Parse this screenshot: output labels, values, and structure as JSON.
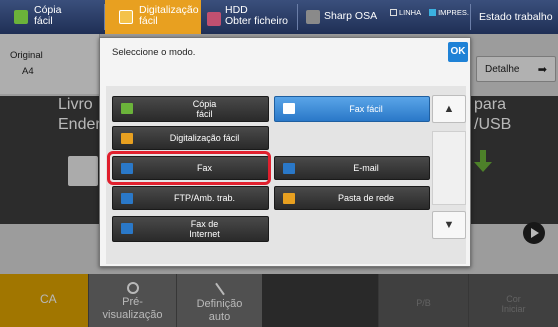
{
  "topbar": {
    "tabs": [
      {
        "label": "Cópia\nfácil",
        "icon": "copy-icon",
        "color": "#6bb33a"
      },
      {
        "label": "Digitalização\nfácil",
        "icon": "scan-icon",
        "color": "#e8a020"
      },
      {
        "label": "HDD\nObter ficheiro",
        "icon": "hdd-icon",
        "color": "#c05070"
      },
      {
        "label": "Sharp OSA",
        "icon": "osa-icon",
        "color": "#8a8a8a"
      }
    ],
    "status_line": "LINHA",
    "status_print": "IMPRES.",
    "job_status": "Estado trabalho"
  },
  "home": {
    "original_label": "Original",
    "original_size": "A4",
    "detail_label": "Detalhe",
    "bg_left_1": "Livro",
    "bg_left_2": "Ender",
    "bg_right_1": "para",
    "bg_right_2": "/USB"
  },
  "bottombar": {
    "ca_label": "CA",
    "preview_label": "Pré-\nvisualização",
    "auto_label": "Definição\nauto",
    "bw_label": "P/B",
    "color_label": "Cor\nIniciar"
  },
  "modal": {
    "title": "Seleccione o modo.",
    "ok_label": "OK",
    "modes": [
      {
        "label": "Cópia\nfácil",
        "icon": "copy-icon",
        "color": "#6bb33a",
        "selected": false
      },
      {
        "label": "Fax fácil",
        "icon": "fax-easy-icon",
        "color": "#2a78c8",
        "selected": true
      },
      {
        "label": "Digitalização fácil",
        "icon": "scan-icon",
        "color": "#e8a020",
        "selected": false
      },
      {
        "label": "Fax",
        "icon": "fax-icon",
        "color": "#2a78c8",
        "selected": false
      },
      {
        "label": "E-mail",
        "icon": "email-icon",
        "color": "#2a78c8",
        "selected": false
      },
      {
        "label": "FTP/Amb. trab.",
        "icon": "ftp-icon",
        "color": "#2a78c8",
        "selected": false
      },
      {
        "label": "Pasta de rede",
        "icon": "folder-icon",
        "color": "#e8a020",
        "selected": false
      },
      {
        "label": "Fax de\nInternet",
        "icon": "internet-fax-icon",
        "color": "#2a78c8",
        "selected": false
      }
    ],
    "scroll_up": "▲",
    "scroll_down": "▼"
  }
}
